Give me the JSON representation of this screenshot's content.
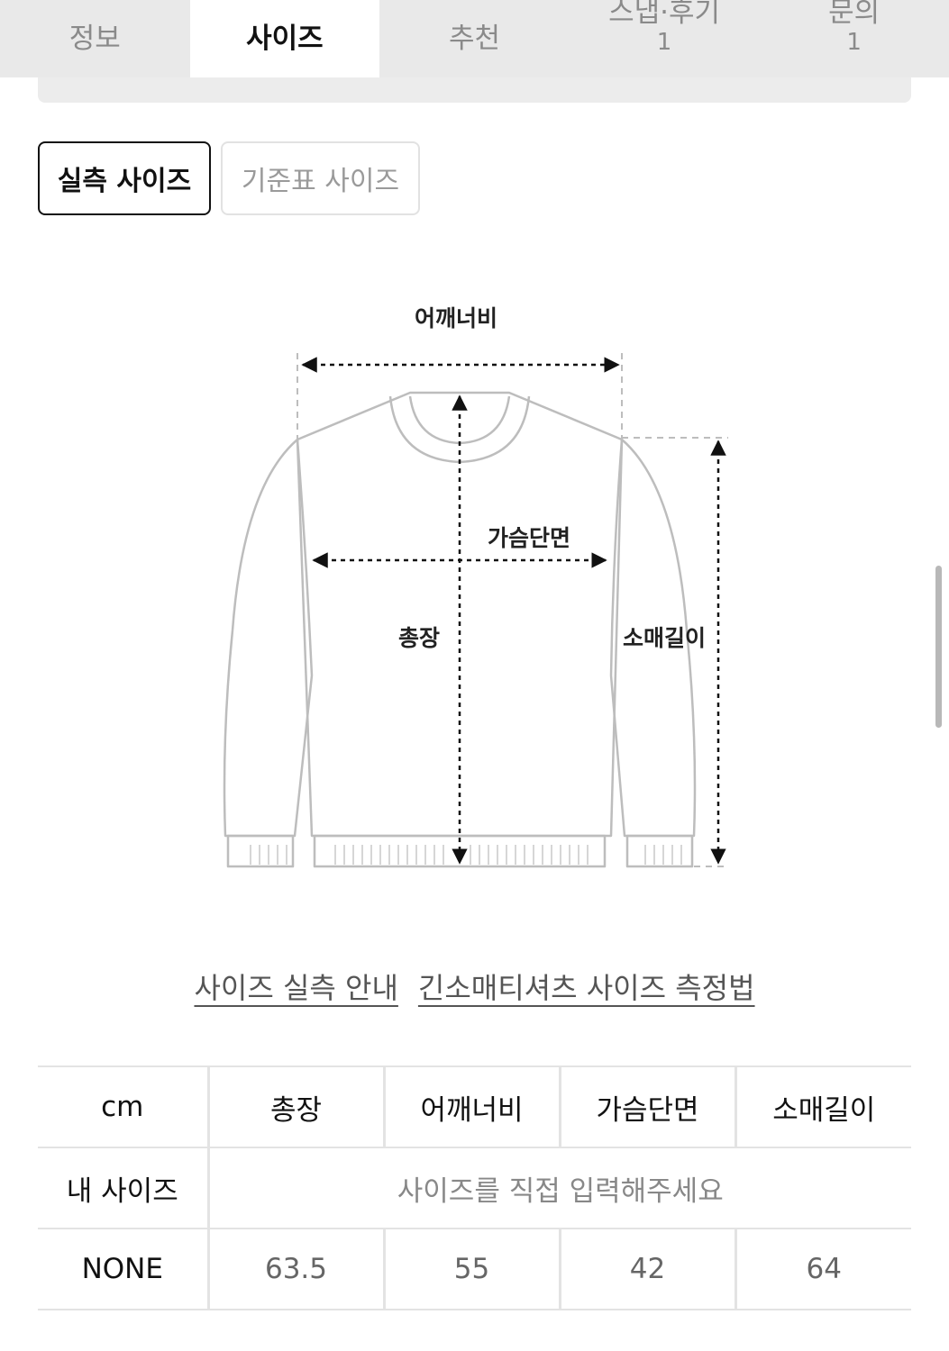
{
  "tabs": [
    {
      "label": "정보",
      "count": ""
    },
    {
      "label": "사이즈",
      "count": "",
      "active": true
    },
    {
      "label": "추천",
      "count": ""
    },
    {
      "label": "스냅·후기",
      "count": "1"
    },
    {
      "label": "문의",
      "count": "1"
    }
  ],
  "toggle": {
    "measured": "실측 사이즈",
    "standard": "기준표 사이즈"
  },
  "diagram": {
    "shoulder": "어깨너비",
    "chest": "가슴단면",
    "length": "총장",
    "sleeve": "소매길이"
  },
  "links": {
    "guide": "사이즈 실측 안내",
    "method": "긴소매티셔츠 사이즈 측정법"
  },
  "table": {
    "unit": "cm",
    "headers": [
      "총장",
      "어깨너비",
      "가슴단면",
      "소매길이"
    ],
    "my_size_label": "내 사이즈",
    "my_size_hint": "사이즈를 직접 입력해주세요",
    "rows": [
      {
        "size": "NONE",
        "values": [
          "63.5",
          "55",
          "42",
          "64"
        ]
      }
    ]
  }
}
